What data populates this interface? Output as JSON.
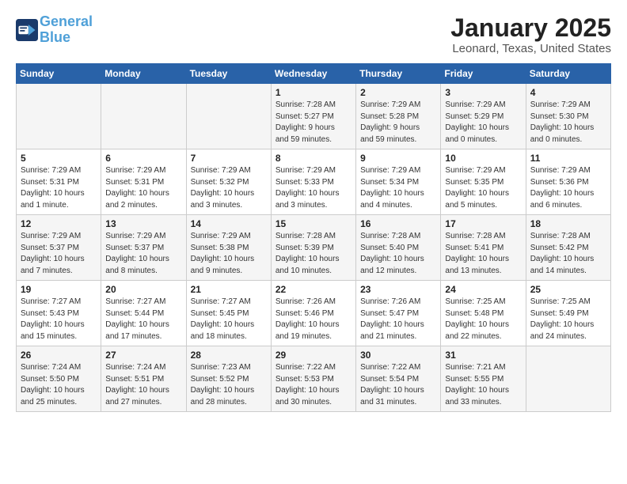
{
  "logo": {
    "line1": "General",
    "line2": "Blue"
  },
  "title": "January 2025",
  "location": "Leonard, Texas, United States",
  "weekdays": [
    "Sunday",
    "Monday",
    "Tuesday",
    "Wednesday",
    "Thursday",
    "Friday",
    "Saturday"
  ],
  "weeks": [
    [
      {
        "day": "",
        "info": ""
      },
      {
        "day": "",
        "info": ""
      },
      {
        "day": "",
        "info": ""
      },
      {
        "day": "1",
        "info": "Sunrise: 7:28 AM\nSunset: 5:27 PM\nDaylight: 9 hours\nand 59 minutes."
      },
      {
        "day": "2",
        "info": "Sunrise: 7:29 AM\nSunset: 5:28 PM\nDaylight: 9 hours\nand 59 minutes."
      },
      {
        "day": "3",
        "info": "Sunrise: 7:29 AM\nSunset: 5:29 PM\nDaylight: 10 hours\nand 0 minutes."
      },
      {
        "day": "4",
        "info": "Sunrise: 7:29 AM\nSunset: 5:30 PM\nDaylight: 10 hours\nand 0 minutes."
      }
    ],
    [
      {
        "day": "5",
        "info": "Sunrise: 7:29 AM\nSunset: 5:31 PM\nDaylight: 10 hours\nand 1 minute."
      },
      {
        "day": "6",
        "info": "Sunrise: 7:29 AM\nSunset: 5:31 PM\nDaylight: 10 hours\nand 2 minutes."
      },
      {
        "day": "7",
        "info": "Sunrise: 7:29 AM\nSunset: 5:32 PM\nDaylight: 10 hours\nand 3 minutes."
      },
      {
        "day": "8",
        "info": "Sunrise: 7:29 AM\nSunset: 5:33 PM\nDaylight: 10 hours\nand 3 minutes."
      },
      {
        "day": "9",
        "info": "Sunrise: 7:29 AM\nSunset: 5:34 PM\nDaylight: 10 hours\nand 4 minutes."
      },
      {
        "day": "10",
        "info": "Sunrise: 7:29 AM\nSunset: 5:35 PM\nDaylight: 10 hours\nand 5 minutes."
      },
      {
        "day": "11",
        "info": "Sunrise: 7:29 AM\nSunset: 5:36 PM\nDaylight: 10 hours\nand 6 minutes."
      }
    ],
    [
      {
        "day": "12",
        "info": "Sunrise: 7:29 AM\nSunset: 5:37 PM\nDaylight: 10 hours\nand 7 minutes."
      },
      {
        "day": "13",
        "info": "Sunrise: 7:29 AM\nSunset: 5:37 PM\nDaylight: 10 hours\nand 8 minutes."
      },
      {
        "day": "14",
        "info": "Sunrise: 7:29 AM\nSunset: 5:38 PM\nDaylight: 10 hours\nand 9 minutes."
      },
      {
        "day": "15",
        "info": "Sunrise: 7:28 AM\nSunset: 5:39 PM\nDaylight: 10 hours\nand 10 minutes."
      },
      {
        "day": "16",
        "info": "Sunrise: 7:28 AM\nSunset: 5:40 PM\nDaylight: 10 hours\nand 12 minutes."
      },
      {
        "day": "17",
        "info": "Sunrise: 7:28 AM\nSunset: 5:41 PM\nDaylight: 10 hours\nand 13 minutes."
      },
      {
        "day": "18",
        "info": "Sunrise: 7:28 AM\nSunset: 5:42 PM\nDaylight: 10 hours\nand 14 minutes."
      }
    ],
    [
      {
        "day": "19",
        "info": "Sunrise: 7:27 AM\nSunset: 5:43 PM\nDaylight: 10 hours\nand 15 minutes."
      },
      {
        "day": "20",
        "info": "Sunrise: 7:27 AM\nSunset: 5:44 PM\nDaylight: 10 hours\nand 17 minutes."
      },
      {
        "day": "21",
        "info": "Sunrise: 7:27 AM\nSunset: 5:45 PM\nDaylight: 10 hours\nand 18 minutes."
      },
      {
        "day": "22",
        "info": "Sunrise: 7:26 AM\nSunset: 5:46 PM\nDaylight: 10 hours\nand 19 minutes."
      },
      {
        "day": "23",
        "info": "Sunrise: 7:26 AM\nSunset: 5:47 PM\nDaylight: 10 hours\nand 21 minutes."
      },
      {
        "day": "24",
        "info": "Sunrise: 7:25 AM\nSunset: 5:48 PM\nDaylight: 10 hours\nand 22 minutes."
      },
      {
        "day": "25",
        "info": "Sunrise: 7:25 AM\nSunset: 5:49 PM\nDaylight: 10 hours\nand 24 minutes."
      }
    ],
    [
      {
        "day": "26",
        "info": "Sunrise: 7:24 AM\nSunset: 5:50 PM\nDaylight: 10 hours\nand 25 minutes."
      },
      {
        "day": "27",
        "info": "Sunrise: 7:24 AM\nSunset: 5:51 PM\nDaylight: 10 hours\nand 27 minutes."
      },
      {
        "day": "28",
        "info": "Sunrise: 7:23 AM\nSunset: 5:52 PM\nDaylight: 10 hours\nand 28 minutes."
      },
      {
        "day": "29",
        "info": "Sunrise: 7:22 AM\nSunset: 5:53 PM\nDaylight: 10 hours\nand 30 minutes."
      },
      {
        "day": "30",
        "info": "Sunrise: 7:22 AM\nSunset: 5:54 PM\nDaylight: 10 hours\nand 31 minutes."
      },
      {
        "day": "31",
        "info": "Sunrise: 7:21 AM\nSunset: 5:55 PM\nDaylight: 10 hours\nand 33 minutes."
      },
      {
        "day": "",
        "info": ""
      }
    ]
  ]
}
